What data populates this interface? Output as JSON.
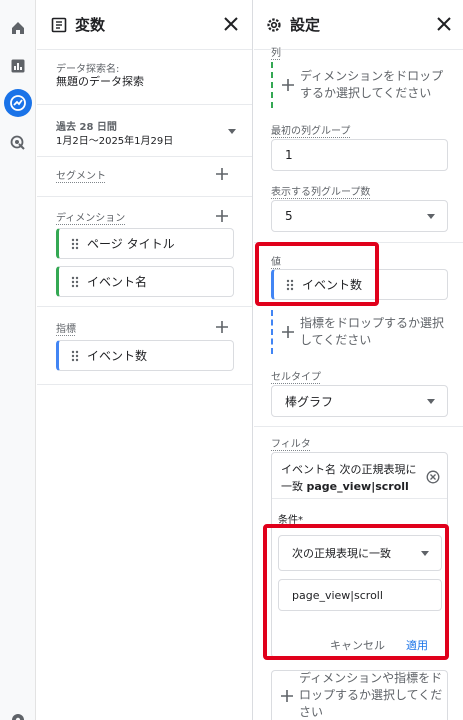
{
  "variables_panel": {
    "title": "変数",
    "exploration_name_label": "データ探索名:",
    "exploration_name": "無題のデータ探索",
    "date_range_label": "過去 28 日間",
    "date_range": "1月2日～2025年1月29日",
    "segments_label": "セグメント",
    "dimensions_label": "ディメンション",
    "dimensions": [
      "ページ タイトル",
      "イベント名"
    ],
    "metrics_label": "指標",
    "metrics": [
      "イベント数"
    ]
  },
  "settings_panel": {
    "title": "設定",
    "columns_label": "列",
    "columns_drop": "ディメンションをドロップするか選択してください",
    "first_column_group_label": "最初の列グループ",
    "first_column_group_value": "1",
    "shown_column_groups_label": "表示する列グループ数",
    "shown_column_groups_value": "5",
    "values_label": "値",
    "values_item": "イベント数",
    "values_drop": "指標をドロップするか選択してください",
    "cell_type_label": "セルタイプ",
    "cell_type_value": "棒グラフ",
    "filters_label": "フィルタ",
    "filter_chip_text": "イベント名 次の正規表現に一致 page_view|scroll",
    "filter_chip_prefix": "イベント名 次の正規表現に",
    "filter_chip_line2_prefix": "一致 ",
    "filter_chip_bold": "page_view|scroll",
    "condition_label": "条件*",
    "condition_value": "次の正規表現に一致",
    "condition_input_value": "page_view|scroll",
    "cancel_label": "キャンセル",
    "apply_label": "適用",
    "filters_drop": "ディメンションや指標をドロップするか選択してください"
  },
  "colors": {
    "accent": "#1a73e8",
    "highlight": "#e0001b",
    "dimension": "#34a853",
    "metric": "#4285f4"
  }
}
